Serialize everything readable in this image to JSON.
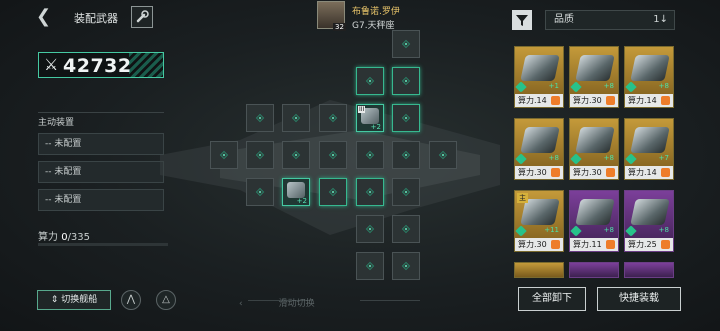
{
  "header": {
    "title": "装配武器"
  },
  "power": {
    "value": "42732"
  },
  "active_equipment": {
    "label": "主动装置",
    "slots": [
      "-- 未配置",
      "-- 未配置",
      "-- 未配置"
    ]
  },
  "calc": {
    "label": "算力",
    "current": "0",
    "max": "/335"
  },
  "buttons": {
    "switch_ship": "切换舰船",
    "unload_all": "全部卸下",
    "quick_equip": "快捷装载"
  },
  "commander": {
    "name": "布鲁诺.罗伊",
    "level": "32",
    "subtitle": "G7.天秤座"
  },
  "grid": {
    "swipe_hint": "滑动切换",
    "equipped": [
      {
        "tag": "III",
        "plus": "+2"
      },
      {
        "tag": "",
        "plus": "+2"
      }
    ]
  },
  "filter": {
    "quality_label": "品质",
    "sort_symbol": "1↓"
  },
  "cards": [
    {
      "label": "算力.14",
      "plus": "+1",
      "badge": "",
      "rarity": "gold"
    },
    {
      "label": "算力.30",
      "plus": "+8",
      "badge": "",
      "rarity": "gold"
    },
    {
      "label": "算力.14",
      "plus": "+8",
      "badge": "",
      "rarity": "gold"
    },
    {
      "label": "算力.30",
      "plus": "+8",
      "badge": "",
      "rarity": "gold"
    },
    {
      "label": "算力.30",
      "plus": "+8",
      "badge": "",
      "rarity": "gold"
    },
    {
      "label": "算力.14",
      "plus": "+7",
      "badge": "",
      "rarity": "gold"
    },
    {
      "label": "算力.30",
      "plus": "+11",
      "badge": "主",
      "rarity": "gold"
    },
    {
      "label": "算力.11",
      "plus": "+8",
      "badge": "",
      "rarity": "purple"
    },
    {
      "label": "算力.25",
      "plus": "+8",
      "badge": "",
      "rarity": "purple"
    }
  ]
}
